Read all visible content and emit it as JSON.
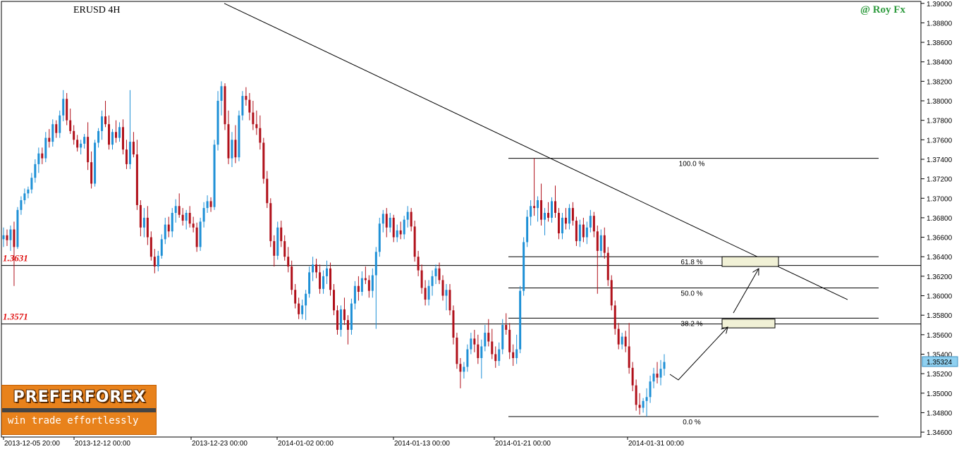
{
  "chart_data": {
    "type": "candlestick",
    "title": "ERUSD 4H",
    "watermark": "@ Roy Fx",
    "ylim": [
      1.3455,
      1.3902
    ],
    "y_ticks": [
      "1.39000",
      "1.38800",
      "1.38600",
      "1.38400",
      "1.38200",
      "1.38000",
      "1.37800",
      "1.37600",
      "1.37400",
      "1.37200",
      "1.37000",
      "1.36800",
      "1.36600",
      "1.36400",
      "1.36200",
      "1.36000",
      "1.35800",
      "1.35600",
      "1.35400",
      "1.35200",
      "1.35000",
      "1.34800",
      "1.34600"
    ],
    "x_tick_labels": [
      "2013-12-05 20:00",
      "2013-12-12 00:00",
      "2013-12-23 00:00",
      "2014-01-02 00:00",
      "2014-01-13 00:00",
      "2014-01-21 00:00",
      "2014-01-31 00:00"
    ],
    "current_price": "1.35324",
    "horizontal_levels": [
      {
        "label": "1.3631",
        "value": 1.3631
      },
      {
        "label": "1.3571",
        "value": 1.3571
      }
    ],
    "fibonacci": {
      "high": 1.3741,
      "low": 1.3476,
      "levels": [
        {
          "label": "100.0 %",
          "value": 1.3741
        },
        {
          "label": "61.8 %",
          "value": 1.364
        },
        {
          "label": "50.0 %",
          "value": 1.3608
        },
        {
          "label": "38.2 %",
          "value": 1.3577
        },
        {
          "label": "0.0 %",
          "value": 1.3476
        }
      ]
    },
    "target_zones": [
      {
        "low": 1.363,
        "high": 1.364
      },
      {
        "low": 1.3567,
        "high": 1.3576
      }
    ],
    "trendline": {
      "start_price": 1.39,
      "end_price": 1.3596
    },
    "up_color": "#1e90d6",
    "down_color": "#b0101a",
    "candles": [
      [
        1.3658,
        1.367,
        1.365,
        1.3662
      ],
      [
        1.3662,
        1.3668,
        1.3651,
        1.3657
      ],
      [
        1.3657,
        1.3672,
        1.3646,
        1.3668
      ],
      [
        1.3668,
        1.3676,
        1.361,
        1.365
      ],
      [
        1.365,
        1.3691,
        1.3648,
        1.3688
      ],
      [
        1.3688,
        1.3702,
        1.3683,
        1.3698
      ],
      [
        1.3698,
        1.371,
        1.3694,
        1.3705
      ],
      [
        1.3705,
        1.3712,
        1.37,
        1.3709
      ],
      [
        1.3709,
        1.3726,
        1.3705,
        1.3721
      ],
      [
        1.3721,
        1.374,
        1.3716,
        1.3735
      ],
      [
        1.3735,
        1.3752,
        1.3726,
        1.3746
      ],
      [
        1.3746,
        1.3752,
        1.3735,
        1.3741
      ],
      [
        1.3741,
        1.3768,
        1.3737,
        1.3762
      ],
      [
        1.3762,
        1.3771,
        1.3752,
        1.3758
      ],
      [
        1.3758,
        1.3781,
        1.3753,
        1.3776
      ],
      [
        1.3776,
        1.378,
        1.3762,
        1.3767
      ],
      [
        1.3767,
        1.379,
        1.3762,
        1.3785
      ],
      [
        1.3785,
        1.3811,
        1.3779,
        1.3802
      ],
      [
        1.3802,
        1.3808,
        1.3775,
        1.378
      ],
      [
        1.378,
        1.3792,
        1.3766,
        1.3769
      ],
      [
        1.3769,
        1.3775,
        1.3755,
        1.376
      ],
      [
        1.376,
        1.3765,
        1.3748,
        1.3752
      ],
      [
        1.3752,
        1.376,
        1.3745,
        1.3756
      ],
      [
        1.3756,
        1.3766,
        1.3751,
        1.3763
      ],
      [
        1.3763,
        1.3778,
        1.3729,
        1.3737
      ],
      [
        1.3737,
        1.3748,
        1.371,
        1.3715
      ],
      [
        1.3715,
        1.376,
        1.3712,
        1.3757
      ],
      [
        1.3757,
        1.3772,
        1.3752,
        1.3769
      ],
      [
        1.3769,
        1.379,
        1.376,
        1.3784
      ],
      [
        1.3784,
        1.38,
        1.3773,
        1.3776
      ],
      [
        1.3776,
        1.3785,
        1.375,
        1.3755
      ],
      [
        1.3755,
        1.3771,
        1.375,
        1.3768
      ],
      [
        1.3768,
        1.378,
        1.3757,
        1.3762
      ],
      [
        1.3762,
        1.3778,
        1.3758,
        1.3773
      ],
      [
        1.3773,
        1.3781,
        1.3745,
        1.375
      ],
      [
        1.375,
        1.376,
        1.373,
        1.3735
      ],
      [
        1.3735,
        1.3811,
        1.373,
        1.3758
      ],
      [
        1.3758,
        1.3768,
        1.3742,
        1.3745
      ],
      [
        1.3745,
        1.376,
        1.3688,
        1.3693
      ],
      [
        1.3693,
        1.3698,
        1.3661,
        1.367
      ],
      [
        1.367,
        1.369,
        1.366,
        1.368
      ],
      [
        1.368,
        1.3692,
        1.3652,
        1.366
      ],
      [
        1.366,
        1.3666,
        1.3636,
        1.364
      ],
      [
        1.364,
        1.3648,
        1.3623,
        1.363
      ],
      [
        1.363,
        1.3646,
        1.3625,
        1.3641
      ],
      [
        1.3641,
        1.3663,
        1.3638,
        1.3658
      ],
      [
        1.3658,
        1.368,
        1.3653,
        1.3673
      ],
      [
        1.3673,
        1.3681,
        1.366,
        1.3666
      ],
      [
        1.3666,
        1.369,
        1.366,
        1.3685
      ],
      [
        1.3685,
        1.3699,
        1.3675,
        1.3692
      ],
      [
        1.3692,
        1.3705,
        1.368,
        1.3683
      ],
      [
        1.3683,
        1.369,
        1.3672,
        1.3677
      ],
      [
        1.3677,
        1.3688,
        1.3668,
        1.3685
      ],
      [
        1.3685,
        1.3692,
        1.367,
        1.3674
      ],
      [
        1.3674,
        1.3681,
        1.3665,
        1.367
      ],
      [
        1.367,
        1.3675,
        1.3645,
        1.365
      ],
      [
        1.365,
        1.368,
        1.3646,
        1.3676
      ],
      [
        1.3676,
        1.3696,
        1.367,
        1.369
      ],
      [
        1.369,
        1.3703,
        1.3685,
        1.3697
      ],
      [
        1.3697,
        1.3701,
        1.3686,
        1.3691
      ],
      [
        1.3691,
        1.376,
        1.3688,
        1.3755
      ],
      [
        1.3755,
        1.381,
        1.3749,
        1.38
      ],
      [
        1.38,
        1.382,
        1.3785,
        1.3815
      ],
      [
        1.3815,
        1.3818,
        1.377,
        1.3776
      ],
      [
        1.3776,
        1.379,
        1.3735,
        1.3741
      ],
      [
        1.3741,
        1.3768,
        1.3732,
        1.376
      ],
      [
        1.376,
        1.3775,
        1.3736,
        1.3742
      ],
      [
        1.3742,
        1.379,
        1.3738,
        1.3785
      ],
      [
        1.3785,
        1.381,
        1.378,
        1.3805
      ],
      [
        1.3805,
        1.3814,
        1.3795,
        1.3801
      ],
      [
        1.3801,
        1.3808,
        1.378,
        1.3788
      ],
      [
        1.3788,
        1.38,
        1.377,
        1.3776
      ],
      [
        1.3776,
        1.379,
        1.3765,
        1.3772
      ],
      [
        1.3772,
        1.3785,
        1.375,
        1.3757
      ],
      [
        1.3757,
        1.3762,
        1.3715,
        1.372
      ],
      [
        1.372,
        1.3728,
        1.369,
        1.3695
      ],
      [
        1.3695,
        1.37,
        1.365,
        1.3656
      ],
      [
        1.3656,
        1.3662,
        1.363,
        1.3641
      ],
      [
        1.3641,
        1.3676,
        1.3637,
        1.367
      ],
      [
        1.367,
        1.3677,
        1.365,
        1.3656
      ],
      [
        1.3656,
        1.3662,
        1.3636,
        1.364
      ],
      [
        1.364,
        1.365,
        1.3624,
        1.363
      ],
      [
        1.363,
        1.3636,
        1.3601,
        1.3606
      ],
      [
        1.3606,
        1.3612,
        1.3587,
        1.3592
      ],
      [
        1.3592,
        1.3598,
        1.3576,
        1.3581
      ],
      [
        1.3581,
        1.3596,
        1.3576,
        1.359
      ],
      [
        1.359,
        1.3606,
        1.3575,
        1.3602
      ],
      [
        1.3602,
        1.363,
        1.3598,
        1.3624
      ],
      [
        1.3624,
        1.364,
        1.3615,
        1.3632
      ],
      [
        1.3632,
        1.3638,
        1.3618,
        1.3624
      ],
      [
        1.3624,
        1.3632,
        1.3602,
        1.3607
      ],
      [
        1.3607,
        1.3626,
        1.3602,
        1.362
      ],
      [
        1.362,
        1.3636,
        1.3612,
        1.3628
      ],
      [
        1.3628,
        1.3634,
        1.36,
        1.3606
      ],
      [
        1.3606,
        1.3612,
        1.358,
        1.3585
      ],
      [
        1.3585,
        1.359,
        1.356,
        1.3565
      ],
      [
        1.3565,
        1.359,
        1.3558,
        1.3586
      ],
      [
        1.3586,
        1.3598,
        1.357,
        1.3575
      ],
      [
        1.3575,
        1.358,
        1.355,
        1.3565
      ],
      [
        1.3565,
        1.3597,
        1.356,
        1.3592
      ],
      [
        1.3592,
        1.3615,
        1.3586,
        1.361
      ],
      [
        1.361,
        1.362,
        1.3595,
        1.3604
      ],
      [
        1.3604,
        1.3625,
        1.36,
        1.3618
      ],
      [
        1.3618,
        1.363,
        1.3612,
        1.3616
      ],
      [
        1.3616,
        1.3621,
        1.3598,
        1.3605
      ],
      [
        1.3605,
        1.3628,
        1.3598,
        1.3621
      ],
      [
        1.3621,
        1.365,
        1.3566,
        1.3645
      ],
      [
        1.3645,
        1.368,
        1.364,
        1.3674
      ],
      [
        1.3674,
        1.3688,
        1.3665,
        1.3684
      ],
      [
        1.3684,
        1.369,
        1.366,
        1.367
      ],
      [
        1.367,
        1.3685,
        1.3665,
        1.368
      ],
      [
        1.368,
        1.3683,
        1.3655,
        1.366
      ],
      [
        1.366,
        1.3673,
        1.3655,
        1.3667
      ],
      [
        1.3667,
        1.3676,
        1.3658,
        1.3663
      ],
      [
        1.3663,
        1.3682,
        1.3658,
        1.3678
      ],
      [
        1.3678,
        1.3692,
        1.367,
        1.3686
      ],
      [
        1.3686,
        1.369,
        1.3666,
        1.3671
      ],
      [
        1.3671,
        1.3677,
        1.3635,
        1.364
      ],
      [
        1.364,
        1.3646,
        1.362,
        1.3626
      ],
      [
        1.3626,
        1.3632,
        1.3602,
        1.3608
      ],
      [
        1.3608,
        1.3616,
        1.359,
        1.3596
      ],
      [
        1.3596,
        1.3616,
        1.359,
        1.361
      ],
      [
        1.361,
        1.3626,
        1.36,
        1.362
      ],
      [
        1.362,
        1.3632,
        1.3612,
        1.3628
      ],
      [
        1.3628,
        1.3634,
        1.3612,
        1.3616
      ],
      [
        1.3616,
        1.3621,
        1.3595,
        1.36
      ],
      [
        1.36,
        1.3612,
        1.3585,
        1.3606
      ],
      [
        1.3606,
        1.3612,
        1.358,
        1.3585
      ],
      [
        1.3585,
        1.359,
        1.355,
        1.3557
      ],
      [
        1.3557,
        1.3562,
        1.3525,
        1.353
      ],
      [
        1.353,
        1.3536,
        1.3505,
        1.3522
      ],
      [
        1.3522,
        1.3532,
        1.3515,
        1.3527
      ],
      [
        1.3527,
        1.355,
        1.3522,
        1.3545
      ],
      [
        1.3545,
        1.3562,
        1.354,
        1.3556
      ],
      [
        1.3556,
        1.3565,
        1.3542,
        1.355
      ],
      [
        1.355,
        1.356,
        1.353,
        1.3536
      ],
      [
        1.3536,
        1.3555,
        1.3515,
        1.3548
      ],
      [
        1.3548,
        1.357,
        1.3543,
        1.3562
      ],
      [
        1.3562,
        1.3576,
        1.3548,
        1.3553
      ],
      [
        1.3553,
        1.3566,
        1.3535,
        1.354
      ],
      [
        1.354,
        1.3548,
        1.3526,
        1.3533
      ],
      [
        1.3533,
        1.3552,
        1.3528,
        1.3545
      ],
      [
        1.3545,
        1.3576,
        1.354,
        1.357
      ],
      [
        1.357,
        1.3582,
        1.356,
        1.3565
      ],
      [
        1.3565,
        1.3572,
        1.3535,
        1.3542
      ],
      [
        1.3542,
        1.355,
        1.3528,
        1.3536
      ],
      [
        1.3536,
        1.356,
        1.353,
        1.3545
      ],
      [
        1.3545,
        1.361,
        1.3541,
        1.3605
      ],
      [
        1.3605,
        1.366,
        1.36,
        1.3655
      ],
      [
        1.3655,
        1.3688,
        1.365,
        1.3681
      ],
      [
        1.3681,
        1.3698,
        1.3672,
        1.3692
      ],
      [
        1.3692,
        1.3741,
        1.3682,
        1.369
      ],
      [
        1.369,
        1.3702,
        1.3676,
        1.3698
      ],
      [
        1.3698,
        1.3715,
        1.3672,
        1.3678
      ],
      [
        1.3678,
        1.369,
        1.3662,
        1.3685
      ],
      [
        1.3685,
        1.3696,
        1.3676,
        1.368
      ],
      [
        1.368,
        1.3701,
        1.3675,
        1.3697
      ],
      [
        1.3697,
        1.3713,
        1.368,
        1.3685
      ],
      [
        1.3685,
        1.369,
        1.3658,
        1.3664
      ],
      [
        1.3664,
        1.3685,
        1.3658,
        1.368
      ],
      [
        1.368,
        1.369,
        1.3668,
        1.3674
      ],
      [
        1.3674,
        1.3694,
        1.3668,
        1.369
      ],
      [
        1.369,
        1.3696,
        1.3672,
        1.3677
      ],
      [
        1.3677,
        1.3681,
        1.3651,
        1.3656
      ],
      [
        1.3656,
        1.3678,
        1.365,
        1.3673
      ],
      [
        1.3673,
        1.368,
        1.3655,
        1.366
      ],
      [
        1.366,
        1.3676,
        1.3653,
        1.367
      ],
      [
        1.367,
        1.3688,
        1.3665,
        1.3682
      ],
      [
        1.3682,
        1.3686,
        1.366,
        1.3666
      ],
      [
        1.3666,
        1.3672,
        1.3602,
        1.3646
      ],
      [
        1.3646,
        1.3668,
        1.364,
        1.3662
      ],
      [
        1.3662,
        1.367,
        1.3638,
        1.3644
      ],
      [
        1.3644,
        1.365,
        1.361,
        1.3616
      ],
      [
        1.3616,
        1.3621,
        1.3585,
        1.359
      ],
      [
        1.359,
        1.3595,
        1.356,
        1.3566
      ],
      [
        1.3566,
        1.3572,
        1.3545,
        1.355
      ],
      [
        1.355,
        1.3562,
        1.3545,
        1.3558
      ],
      [
        1.3558,
        1.3564,
        1.3542,
        1.3548
      ],
      [
        1.3548,
        1.3572,
        1.352,
        1.3526
      ],
      [
        1.3526,
        1.3532,
        1.3502,
        1.3508
      ],
      [
        1.3508,
        1.3514,
        1.3482,
        1.3488
      ],
      [
        1.3488,
        1.35,
        1.3478,
        1.3485
      ],
      [
        1.3485,
        1.3495,
        1.348,
        1.3492
      ],
      [
        1.3492,
        1.3505,
        1.3476,
        1.3496
      ],
      [
        1.3496,
        1.3518,
        1.349,
        1.3512
      ],
      [
        1.3512,
        1.3526,
        1.3505,
        1.352
      ],
      [
        1.352,
        1.3532,
        1.351,
        1.3516
      ],
      [
        1.3516,
        1.3534,
        1.3508,
        1.3525
      ],
      [
        1.3525,
        1.354,
        1.3518,
        1.3532
      ]
    ]
  }
}
